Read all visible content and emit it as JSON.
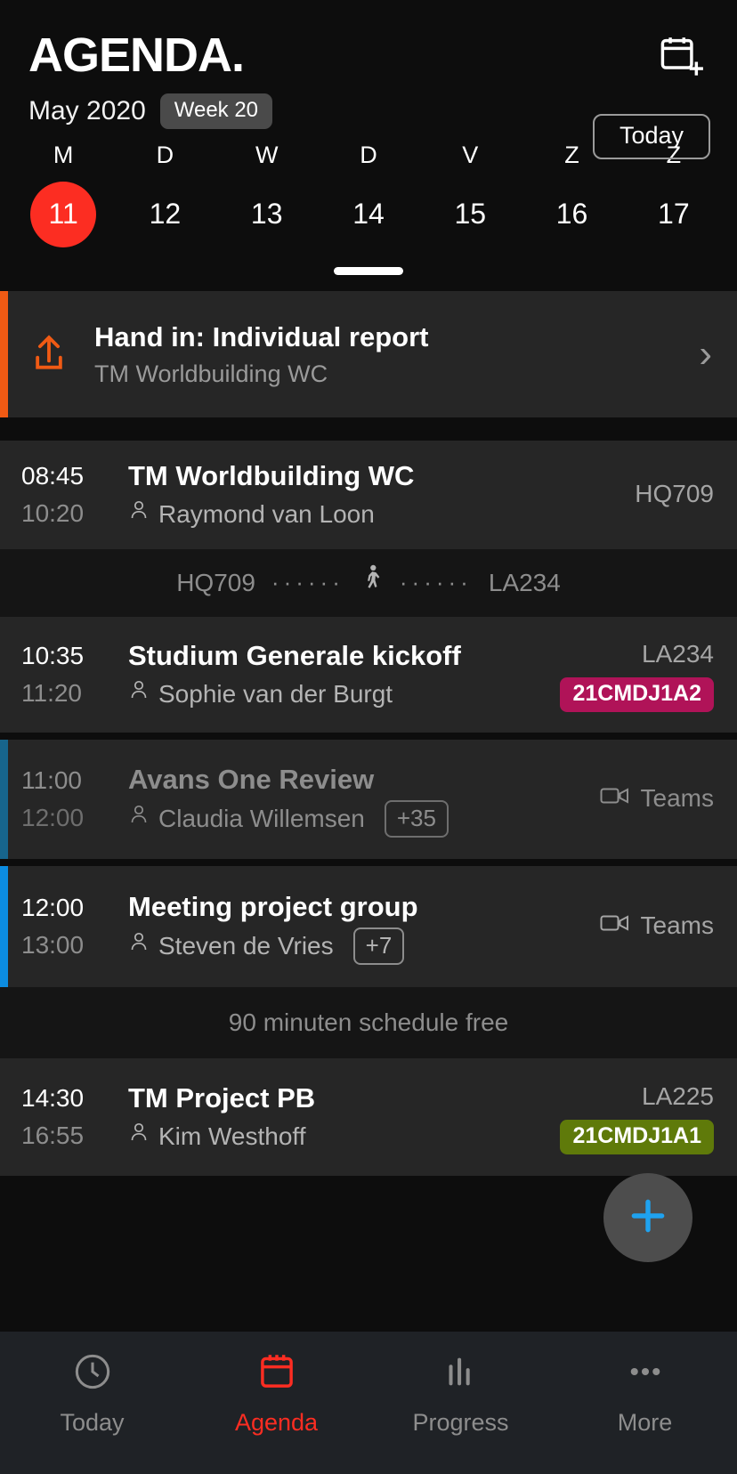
{
  "header": {
    "title": "AGENDA.",
    "month": "May 2020",
    "week_chip": "Week 20",
    "today_button": "Today",
    "add_icon": "calendar-add-icon"
  },
  "week_strip": {
    "days": [
      {
        "letter": "M",
        "num": "11",
        "active": true
      },
      {
        "letter": "D",
        "num": "12",
        "active": false
      },
      {
        "letter": "W",
        "num": "13",
        "active": false
      },
      {
        "letter": "D",
        "num": "14",
        "active": false
      },
      {
        "letter": "V",
        "num": "15",
        "active": false
      },
      {
        "letter": "Z",
        "num": "16",
        "active": false
      },
      {
        "letter": "Z",
        "num": "17",
        "active": false
      }
    ],
    "active_color": "#fc2d22"
  },
  "handin": {
    "title": "Hand in: Individual report",
    "subtitle": "TM Worldbuilding WC",
    "accent_color": "#f05a14",
    "icon": "upload-icon",
    "chevron": "›"
  },
  "events": [
    {
      "start": "08:45",
      "end": "10:20",
      "title": "TM Worldbuilding WC",
      "person": "Raymond van Loon",
      "location": "HQ709",
      "badge": "",
      "badge_color": "",
      "chip": "",
      "accent_color": "",
      "dimmed": false,
      "online": false
    },
    {
      "start": "10:35",
      "end": "11:20",
      "title": "Studium Generale kickoff",
      "person": "Sophie van der Burgt",
      "location": "LA234",
      "badge": "21CMDJ1A2",
      "badge_color": "#b01358",
      "chip": "",
      "accent_color": "",
      "dimmed": false,
      "online": false
    },
    {
      "start": "11:00",
      "end": "12:00",
      "title": "Avans One Review",
      "person": "Claudia Willemsen",
      "location": "Teams",
      "badge": "",
      "badge_color": "",
      "chip": "+35",
      "accent_color": "#17658c",
      "dimmed": true,
      "online": true
    },
    {
      "start": "12:00",
      "end": "13:00",
      "title": "Meeting project group",
      "person": "Steven de Vries",
      "location": "Teams",
      "badge": "",
      "badge_color": "",
      "chip": "+7",
      "accent_color": "#0c8ce0",
      "dimmed": false,
      "online": true
    },
    {
      "start": "14:30",
      "end": "16:55",
      "title": "TM Project PB",
      "person": "Kim Westhoff",
      "location": "LA225",
      "badge": "21CMDJ1A1",
      "badge_color": "#5f7a0a",
      "chip": "",
      "accent_color": "",
      "dimmed": false,
      "online": false
    }
  ],
  "travel_divider": {
    "from": "HQ709",
    "to": "LA234",
    "dots_left": "······",
    "dots_right": "······",
    "icon": "walking-person-icon"
  },
  "free_divider": {
    "text": "90 minuten schedule free"
  },
  "fab": {
    "icon": "plus-icon",
    "color": "#1fa2ef",
    "background": "#4d4d4d"
  },
  "bottom_nav": {
    "items": [
      {
        "label": "Today",
        "icon": "clock-icon",
        "active": false
      },
      {
        "label": "Agenda",
        "icon": "calendar-icon",
        "active": true
      },
      {
        "label": "Progress",
        "icon": "bar-chart-icon",
        "active": false
      },
      {
        "label": "More",
        "icon": "ellipsis-icon",
        "active": false
      }
    ],
    "active_color": "#fc2d22",
    "inactive_color": "#8d8d8d"
  }
}
